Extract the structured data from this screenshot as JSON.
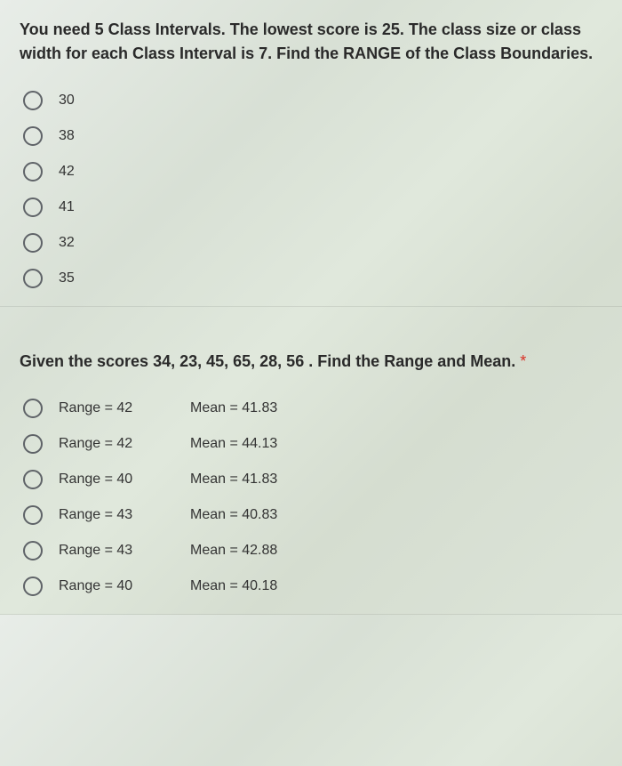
{
  "question1": {
    "text": "You need 5 Class Intervals.  The lowest score is 25. The class size or class width for each Class Interval is 7.   Find the RANGE of the Class Boundaries.",
    "options": [
      "30",
      "38",
      "42",
      "41",
      "32",
      "35"
    ]
  },
  "question2": {
    "text": "Given the scores 34,  23,  45,  65,  28,  56 .  Find the Range and Mean.",
    "required": "*",
    "options": [
      {
        "range": "Range = 42",
        "mean": "Mean = 41.83"
      },
      {
        "range": "Range = 42",
        "mean": "Mean = 44.13"
      },
      {
        "range": "Range = 40",
        "mean": "Mean = 41.83"
      },
      {
        "range": "Range = 43",
        "mean": "Mean = 40.83"
      },
      {
        "range": "Range = 43",
        "mean": "Mean = 42.88"
      },
      {
        "range": "Range = 40",
        "mean": "Mean = 40.18"
      }
    ]
  }
}
